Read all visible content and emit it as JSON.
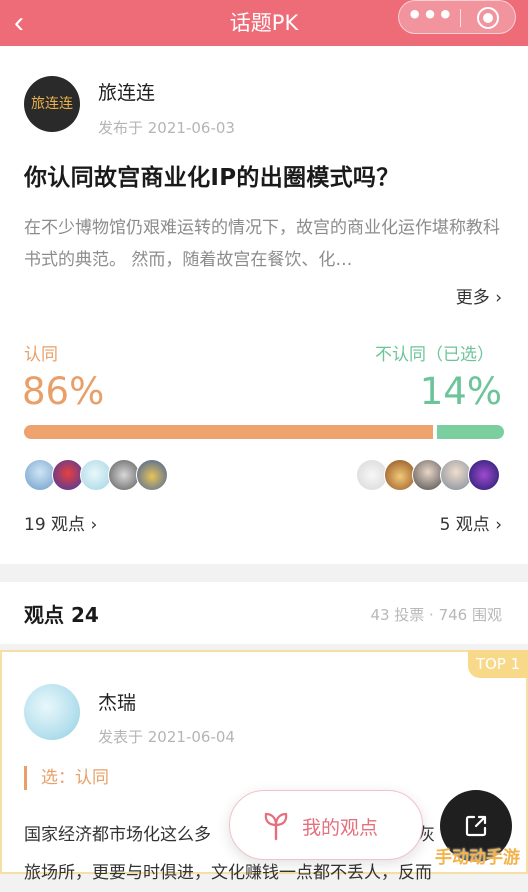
{
  "topbar": {
    "back_icon": "chevron-left-icon",
    "title": "话题PK",
    "more_icon": "more-dots-icon",
    "target_icon": "target-icon"
  },
  "post": {
    "author_logo_text": "旅连连",
    "author": "旅连连",
    "date": "发布于 2021-06-03",
    "question": "你认同故宫商业化IP的出圈模式吗？",
    "description": "在不少博物馆仍艰难运转的情况下，故宫的商业化运作堪称教科书式的典范。 然而，随着故宫在餐饮、化…",
    "more": "更多 ›"
  },
  "vote": {
    "left_label": "认同",
    "right_label": "不认同（已选）",
    "left_percent": "86%",
    "right_percent": "14%",
    "left_share": 0.86,
    "right_share": 0.14,
    "left_color": "#eea26e",
    "right_color": "#7bcf9e",
    "left_count": "19 观点 ›",
    "right_count": "5 观点 ›"
  },
  "views_header": {
    "title": "观点 24",
    "stats": "43 投票 · 746 围观"
  },
  "comment": {
    "badge": "TOP 1",
    "name": "杰瑞",
    "date": "发表于 2021-06-04",
    "choice": "选：认同",
    "line1": "国家经济都市场化这么多",
    "line1_end": "灰",
    "line2": "旅场所，更要与时俱进，文化赚钱一点都不丢人，反而"
  },
  "floating": {
    "my_view": "我的观点",
    "my_view_icon": "sprout-icon",
    "share_icon": "share-icon"
  },
  "watermark": "手动动手游"
}
